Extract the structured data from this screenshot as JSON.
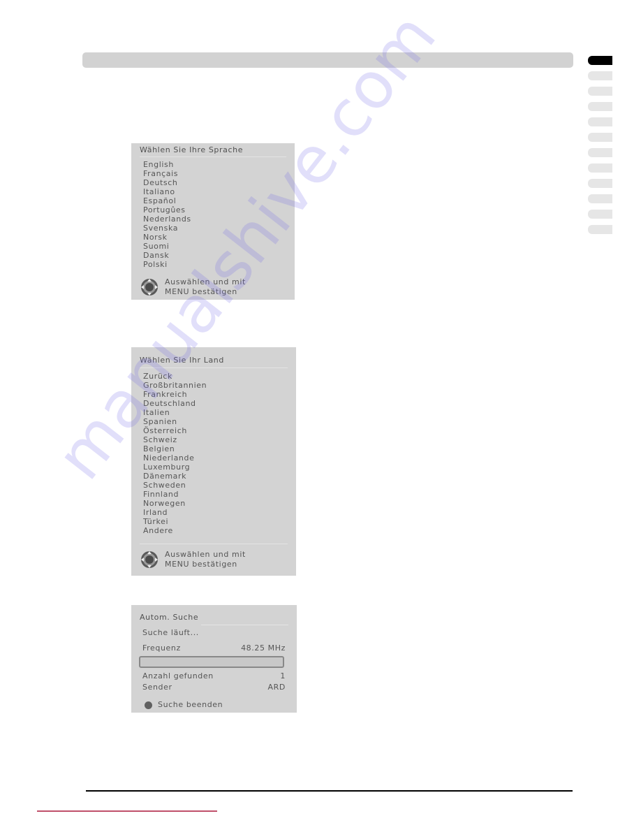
{
  "page": {
    "side_tabs": {
      "count": 12,
      "active_index": 0
    }
  },
  "language_menu": {
    "title": "Wählen Sie Ihre Sprache",
    "items": [
      "English",
      "Français",
      "Deutsch",
      "Italiano",
      "Español",
      "Portugûes",
      "Nederlands",
      "Svenska",
      "Norsk",
      "Suomi",
      "Dansk",
      "Polski"
    ],
    "hint_line1": "Auswählen und mit",
    "hint_line2": "MENU bestätigen",
    "hint_icon": "remote-navigation-ring-icon"
  },
  "country_menu": {
    "title": "Wählen Sie Ihr Land",
    "items": [
      "Zurück",
      "Großbritannien",
      "Frankreich",
      "Deutschland",
      "Italien",
      "Spanien",
      "Österreich",
      "Schweiz",
      "Belgien",
      "Niederlande",
      "Luxemburg",
      "Dänemark",
      "Schweden",
      "Finnland",
      "Norwegen",
      "Irland",
      "Türkei",
      "Andere"
    ],
    "hint_line1": "Auswählen und mit",
    "hint_line2": "MENU bestätigen",
    "hint_icon": "remote-navigation-ring-icon"
  },
  "auto_search": {
    "title": "Autom. Suche",
    "status": "Suche läuft...",
    "frequency_label": "Frequenz",
    "frequency_value": "48.25 MHz",
    "progress_fraction": 0,
    "found_label": "Anzahl gefunden",
    "found_value": "1",
    "channel_label": "Sender",
    "channel_value": "ARD",
    "stop_label": "Suche beenden",
    "stop_icon": "red-button-icon"
  },
  "watermark": "manualshive.com"
}
